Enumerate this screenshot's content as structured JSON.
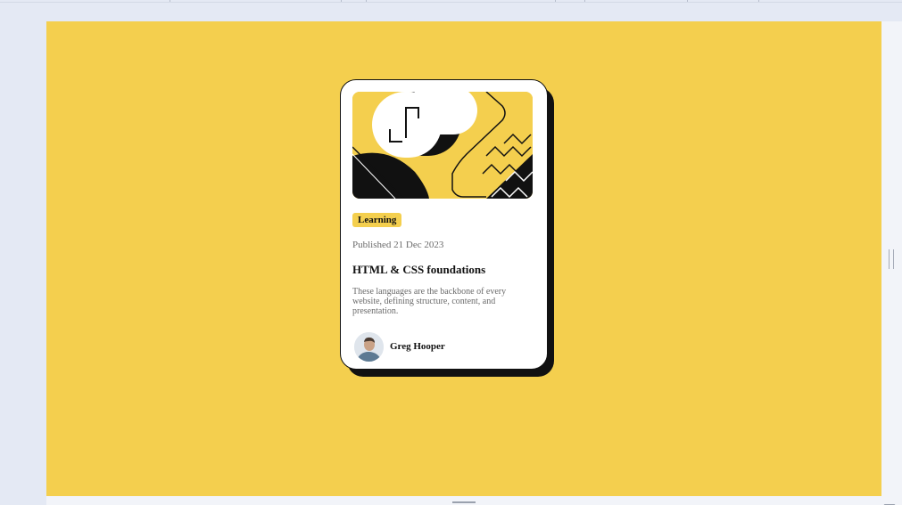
{
  "card": {
    "tag": "Learning",
    "published": "Published 21 Dec 2023",
    "title": "HTML & CSS foundations",
    "description": "These languages are the backbone of every website, defining structure, content, and presentation.",
    "author": "Greg Hooper"
  },
  "colors": {
    "background": "#f4cf4e",
    "card": "#ffffff",
    "shadow": "#111111",
    "muted_text": "#6b6b6b"
  },
  "icons": {
    "illustration": "abstract-illustration",
    "avatar": "author-avatar"
  }
}
